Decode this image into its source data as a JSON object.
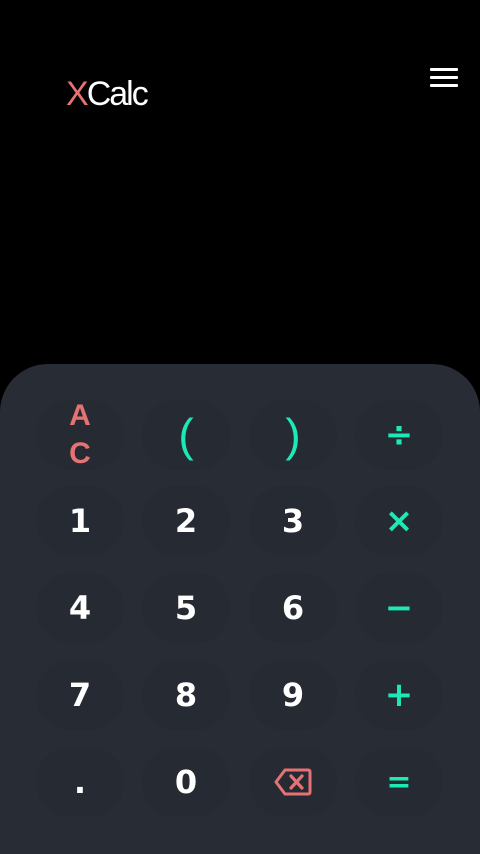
{
  "header": {
    "brand_x": "X",
    "brand_name": "Calc"
  },
  "display": {
    "expression": ""
  },
  "keys": {
    "all_clear": [
      "A",
      "C"
    ],
    "open_paren": "(",
    "close_paren": ")",
    "divide": "÷",
    "one": "1",
    "two": "2",
    "three": "3",
    "multiply": "×",
    "four": "4",
    "five": "5",
    "six": "6",
    "minus": "−",
    "seven": "7",
    "eight": "8",
    "nine": "9",
    "plus": "+",
    "decimal": ".",
    "zero": "0",
    "backspace_icon": "backspace-icon",
    "equals": "="
  },
  "colors": {
    "background": "#000000",
    "keypad": "#282c34",
    "key": "#262a32",
    "accent_teal": "#1de9b6",
    "accent_red": "#e57373",
    "digit": "#ffffff"
  }
}
